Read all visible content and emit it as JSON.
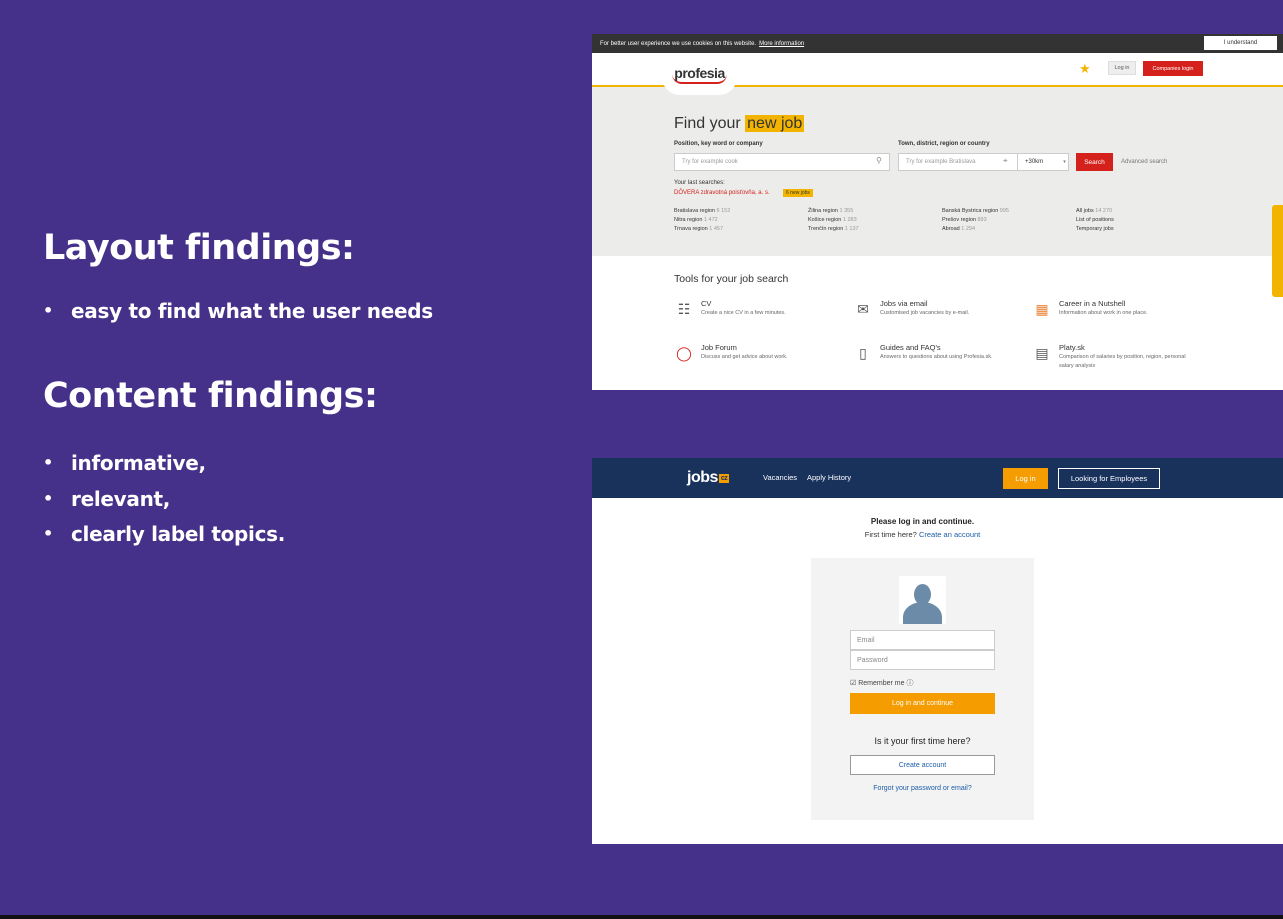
{
  "slide": {
    "layout_heading": "Layout findings:",
    "layout_bullets": [
      "easy to find what the user needs"
    ],
    "content_heading": "Content findings:",
    "content_bullets": [
      "informative,",
      "relevant,",
      "clearly label topics."
    ]
  },
  "profesia": {
    "cookie_text": "For better user experience we use cookies on this website.",
    "cookie_more": "More information",
    "cookie_button": "I understand",
    "logo": "profesia",
    "star_icon": "star-icon",
    "login": "Log in",
    "companies_login": "Companies login",
    "find_prefix": "Find your",
    "find_highlight": "new job",
    "position_label": "Position, key word or company",
    "position_placeholder": "Try for example cook",
    "town_label": "Town, district, region or country",
    "town_placeholder": "Try for example Bratislava",
    "radius": "+30km",
    "search": "Search",
    "advanced": "Advanced search",
    "last_label": "Your last searches:",
    "last_item": "DÔVERA zdravotná poisťovňa, a. s.",
    "last_badge": "6 new jobs",
    "regions": [
      {
        "name": "Bratislava region",
        "count": "6 152"
      },
      {
        "name": "Žilina region",
        "count": "1 355"
      },
      {
        "name": "Banská Bystrica region",
        "count": "995"
      },
      {
        "name": "All jobs",
        "count": "14 270"
      },
      {
        "name": "Nitra region",
        "count": "1 472"
      },
      {
        "name": "Košice region",
        "count": "1 283"
      },
      {
        "name": "Prešov region",
        "count": "893"
      },
      {
        "name": "List of positions",
        "count": ""
      },
      {
        "name": "Trnava region",
        "count": "1 457"
      },
      {
        "name": "Trenčín region",
        "count": "1 137"
      },
      {
        "name": "Abroad",
        "count": "1 294"
      },
      {
        "name": "Temporary jobs",
        "count": ""
      }
    ],
    "tools_title": "Tools for your job search",
    "tools": [
      {
        "title": "CV",
        "desc": "Create a nice CV in a few minutes.",
        "icon": "cv-icon"
      },
      {
        "title": "Jobs via email",
        "desc": "Customised job vacancies by e-mail.",
        "icon": "mail-icon"
      },
      {
        "title": "Career in a Nutshell",
        "desc": "Information about work in one place.",
        "icon": "cube-icon"
      },
      {
        "title": "Job Forum",
        "desc": "Discuss and get advice about work.",
        "icon": "chat-icon"
      },
      {
        "title": "Guides and FAQ's",
        "desc": "Answers to questions about using Profesia.sk.",
        "icon": "book-icon"
      },
      {
        "title": "Platy.sk",
        "desc": "Comparison of salaries by position, region, personal salary analysis",
        "icon": "salary-icon"
      }
    ]
  },
  "jobscz": {
    "logo": "jobs",
    "logo_suffix": "cz",
    "nav_vacancies": "Vacancies",
    "nav_history": "Apply History",
    "login": "Log in",
    "employees": "Looking for Employees",
    "please": "Please log in and continue.",
    "first_prefix": "First time here?",
    "first_link": "Create an account",
    "email_placeholder": "Email",
    "password_placeholder": "Password",
    "remember": "Remember me",
    "submit": "Log in and continue",
    "is_first": "Is it your first time here?",
    "create": "Create account",
    "forgot": "Forgot your password or email?"
  }
}
